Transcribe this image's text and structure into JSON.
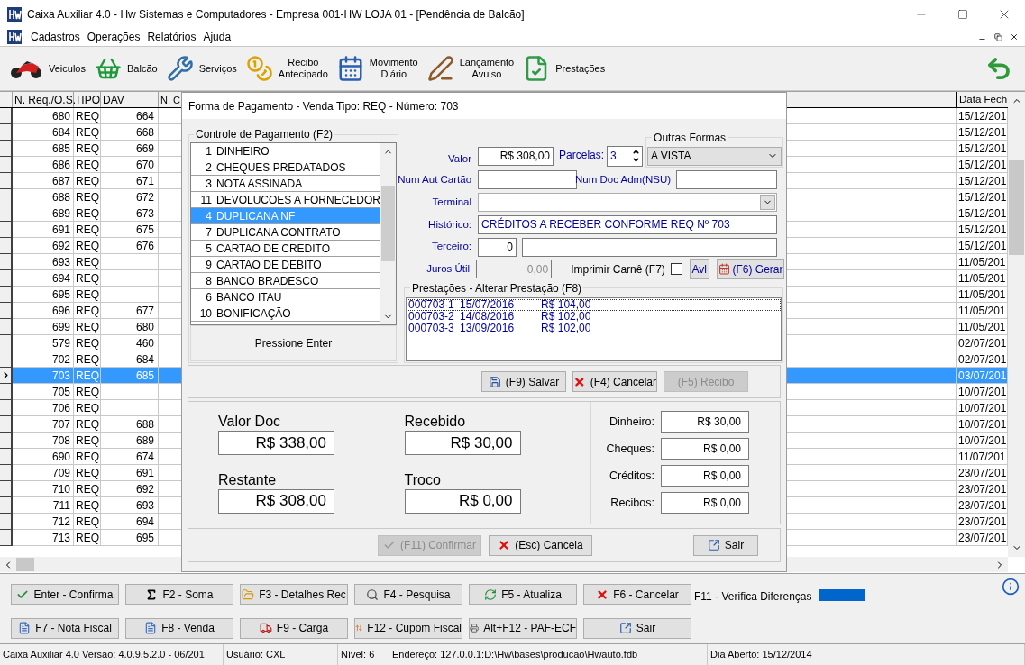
{
  "window": {
    "title": "Caixa Auxiliar 4.0 - Hw Sistemas e Computadores - Empresa 001-HW LOJA 01 - [Pendência de Balcão]"
  },
  "menu": [
    "Cadastros",
    "Operações",
    "Relatórios",
    "Ajuda"
  ],
  "toolbar": [
    {
      "label": "Veiculos",
      "kind": "motorcycle"
    },
    {
      "label": "Balcão",
      "kind": "basket"
    },
    {
      "label": "Serviços",
      "kind": "tools"
    },
    {
      "label": "Recibo\nAntecipado",
      "kind": "coins"
    },
    {
      "label": "Movimento\nDiário",
      "kind": "calendar"
    },
    {
      "label": "Lançamento\nAvulso",
      "kind": "pen"
    },
    {
      "label": "Prestações",
      "kind": "installments"
    }
  ],
  "table": {
    "columns": [
      "N. Req./O.S.",
      "TIPO",
      "DAV",
      "N. C",
      "Data Fech"
    ],
    "rows": [
      {
        "n_req": "680",
        "tipo": "REQ",
        "dav": "664",
        "data_fech": "15/12/201",
        "selected": false
      },
      {
        "n_req": "684",
        "tipo": "REQ",
        "dav": "668",
        "data_fech": "15/12/201",
        "selected": false
      },
      {
        "n_req": "685",
        "tipo": "REQ",
        "dav": "669",
        "data_fech": "15/12/201",
        "selected": false
      },
      {
        "n_req": "686",
        "tipo": "REQ",
        "dav": "670",
        "data_fech": "15/12/201",
        "selected": false
      },
      {
        "n_req": "687",
        "tipo": "REQ",
        "dav": "671",
        "data_fech": "15/12/201",
        "selected": false
      },
      {
        "n_req": "688",
        "tipo": "REQ",
        "dav": "672",
        "data_fech": "15/12/201",
        "selected": false
      },
      {
        "n_req": "689",
        "tipo": "REQ",
        "dav": "673",
        "data_fech": "15/12/201",
        "selected": false
      },
      {
        "n_req": "691",
        "tipo": "REQ",
        "dav": "675",
        "data_fech": "15/12/201",
        "selected": false
      },
      {
        "n_req": "692",
        "tipo": "REQ",
        "dav": "676",
        "data_fech": "15/12/201",
        "selected": false
      },
      {
        "n_req": "693",
        "tipo": "REQ",
        "data_fech": "11/05/201",
        "selected": false
      },
      {
        "n_req": "694",
        "tipo": "REQ",
        "data_fech": "11/05/201",
        "selected": false
      },
      {
        "n_req": "695",
        "tipo": "REQ",
        "data_fech": "11/05/201",
        "selected": false
      },
      {
        "n_req": "696",
        "tipo": "REQ",
        "dav": "677",
        "data_fech": "11/05/201",
        "selected": false
      },
      {
        "n_req": "699",
        "tipo": "REQ",
        "dav": "680",
        "data_fech": "11/05/201",
        "selected": false
      },
      {
        "n_req": "579",
        "tipo": "REQ",
        "dav": "460",
        "data_fech": "02/07/201",
        "selected": false
      },
      {
        "n_req": "702",
        "tipo": "REQ",
        "dav": "684",
        "data_fech": "02/07/201",
        "selected": false
      },
      {
        "n_req": "703",
        "tipo": "REQ",
        "dav": "685",
        "data_fech": "03/07/201",
        "selected": true
      },
      {
        "n_req": "705",
        "tipo": "REQ",
        "data_fech": "10/07/201",
        "selected": false
      },
      {
        "n_req": "706",
        "tipo": "REQ",
        "data_fech": "10/07/201",
        "selected": false
      },
      {
        "n_req": "707",
        "tipo": "REQ",
        "dav": "688",
        "data_fech": "10/07/201",
        "selected": false
      },
      {
        "n_req": "708",
        "tipo": "REQ",
        "dav": "689",
        "data_fech": "10/07/201",
        "selected": false
      },
      {
        "n_req": "690",
        "tipo": "REQ",
        "dav": "674",
        "data_fech": "11/07/201",
        "selected": false
      },
      {
        "n_req": "709",
        "tipo": "REQ",
        "dav": "691",
        "data_fech": "23/07/201",
        "selected": false
      },
      {
        "n_req": "710",
        "tipo": "REQ",
        "dav": "692",
        "data_fech": "23/07/201",
        "selected": false
      },
      {
        "n_req": "711",
        "tipo": "REQ",
        "dav": "693",
        "data_fech": "23/07/201",
        "selected": false
      },
      {
        "n_req": "712",
        "tipo": "REQ",
        "dav": "694",
        "data_fech": "23/07/201",
        "selected": false
      },
      {
        "n_req": "713",
        "tipo": "REQ",
        "dav": "695",
        "data_fech": "23/07/201",
        "selected": false
      }
    ]
  },
  "dialog": {
    "title": "Forma de Pagamento - Venda Tipo: REQ - Número: 703",
    "payment_group": {
      "legend": "Controle de Pagamento (F2)",
      "hint": "Pressione Enter",
      "items": [
        {
          "code": "1",
          "name": "DINHEIRO",
          "selected": false
        },
        {
          "code": "2",
          "name": "CHEQUES PREDATADOS",
          "selected": false
        },
        {
          "code": "3",
          "name": "NOTA ASSINADA",
          "selected": false
        },
        {
          "code": "11",
          "name": "DEVOLUCOES A FORNECEDOR",
          "selected": false
        },
        {
          "code": "4",
          "name": "DUPLICANA NF",
          "selected": true
        },
        {
          "code": "7",
          "name": "DUPLICANA CONTRATO",
          "selected": false
        },
        {
          "code": "5",
          "name": "CARTAO DE CREDITO",
          "selected": false
        },
        {
          "code": "9",
          "name": "CARTAO DE DEBITO",
          "selected": false
        },
        {
          "code": "8",
          "name": "BANCO BRADESCO",
          "selected": false
        },
        {
          "code": "6",
          "name": "BANCO ITAU",
          "selected": false
        },
        {
          "code": "10",
          "name": "BONIFICAÇÃO",
          "selected": false
        }
      ]
    },
    "valor": {
      "label": "Valor",
      "value": "R$ 308,00"
    },
    "parcelas": {
      "label": "Parcelas:",
      "value": "3"
    },
    "outras_formas": {
      "legend": "Outras Formas",
      "value": "A VISTA"
    },
    "num_aut_cartao": {
      "label": "Num Aut Cartão"
    },
    "num_doc_adm": {
      "label": "Num Doc Adm(NSU)"
    },
    "terminal": {
      "label": "Terminal"
    },
    "historico": {
      "label": "Histórico:",
      "value": "CRÉDITOS A RECEBER CONFORME REQ Nº 703"
    },
    "terceiro": {
      "label": "Terceiro:",
      "value": "0"
    },
    "juros": {
      "label": "Juros Útil",
      "value": "0,00",
      "disabled": true
    },
    "imprimir_carne": {
      "label": "Imprimir Carnê (F7)",
      "checked": false
    },
    "avl_button": "Avl",
    "gerar_button": "(F6) Gerar",
    "prestacoes": {
      "legend": "Prestações - Alterar Prestação (F8)",
      "rows": [
        {
          "code": "000703-1",
          "date": "15/07/2016",
          "value": "R$ 104,00",
          "selected": true
        },
        {
          "code": "000703-2",
          "date": "14/08/2016",
          "value": "R$ 102,00",
          "selected": false
        },
        {
          "code": "000703-3",
          "date": "13/09/2016",
          "value": "R$ 102,00",
          "selected": false
        }
      ]
    },
    "actions": [
      {
        "label": "(F9) Salvar",
        "kind": "save",
        "disabled": false
      },
      {
        "label": "(F4) Cancelar",
        "kind": "cancel",
        "disabled": false
      },
      {
        "label": "(F5) Recibo",
        "kind": "plain",
        "disabled": true
      }
    ],
    "totals": [
      {
        "label": "Valor Doc",
        "value": "R$ 338,00"
      },
      {
        "label": "Recebido",
        "value": "R$ 30,00"
      },
      {
        "label": "Restante",
        "value": "R$ 308,00"
      },
      {
        "label": "Troco",
        "value": "R$ 0,00"
      }
    ],
    "summary": [
      {
        "label": "Dinheiro:",
        "value": "R$ 30,00"
      },
      {
        "label": "Cheques:",
        "value": "R$ 0,00"
      },
      {
        "label": "Créditos:",
        "value": "R$ 0,00"
      },
      {
        "label": "Recibos:",
        "value": "R$ 0,00"
      }
    ],
    "footer_buttons": [
      {
        "label": "(F11) Confirmar",
        "kind": "confirm",
        "disabled": true
      },
      {
        "label": "(Esc) Cancela",
        "kind": "cancel",
        "disabled": false
      },
      {
        "label": "Sair",
        "kind": "exit",
        "disabled": false
      }
    ]
  },
  "bottom_buttons": [
    {
      "label": "Enter - Confirma",
      "kind": "check"
    },
    {
      "label": "F2 - Soma",
      "kind": "sum"
    },
    {
      "label": "F3 - Detalhes Rec",
      "kind": "folder"
    },
    {
      "label": "F4 - Pesquisa",
      "kind": "search"
    },
    {
      "label": "F5 - Atualiza",
      "kind": "refresh"
    },
    {
      "label": "F6 - Cancelar",
      "kind": "cancel"
    },
    {
      "label": "F7 - Nota Fiscal",
      "kind": "document"
    },
    {
      "label": "F8 - Venda",
      "kind": "document"
    },
    {
      "label": "F9 - Carga",
      "kind": "truck"
    },
    {
      "label": "F12 - Cupom Fiscal",
      "kind": "sort"
    },
    {
      "label": "Alt+F12 - PAF-ECF",
      "kind": "printer"
    },
    {
      "label": "Sair",
      "kind": "exit"
    }
  ],
  "verifica": {
    "label": "F11 - Verifica Diferenças",
    "color": "#0066cc"
  },
  "status_bar": [
    "Caixa Auxiliar 4.0 Versão: 4.0.9.5.2.0 - 06/201",
    "Usuário: CXL",
    "Nível: 6",
    "Endereço: 127.0.0.1:D:\\Hw\\bases\\producao\\Hwauto.fdb",
    "Dia Aberto: 15/12/2014"
  ]
}
